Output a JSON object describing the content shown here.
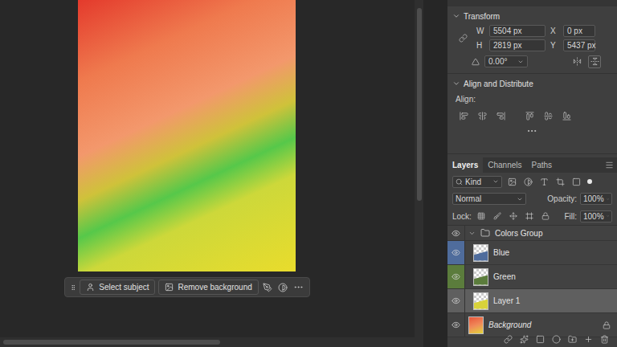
{
  "contextual_taskbar": {
    "buttons": [
      {
        "label": "Select subject"
      },
      {
        "label": "Remove background"
      }
    ]
  },
  "properties": {
    "transform": {
      "title": "Transform",
      "expanded": true,
      "fields": [
        {
          "label": "W",
          "value": "5504 px"
        },
        {
          "label": "X",
          "value": "0 px"
        },
        {
          "label": "H",
          "value": "2819 px"
        },
        {
          "label": "Y",
          "value": "5437 px"
        }
      ],
      "angle": "0.00°"
    },
    "align": {
      "title": "Align and Distribute",
      "expanded": true,
      "label": "Align:"
    }
  },
  "layers_panel": {
    "tabs": [
      {
        "label": "Layers",
        "selected": true
      },
      {
        "label": "Channels",
        "selected": false
      },
      {
        "label": "Paths",
        "selected": false
      }
    ],
    "filter": "Kind",
    "blend_mode": "Normal",
    "opacity_label": "Opacity:",
    "opacity": "100%",
    "lock_label": "Lock:",
    "fill_label": "Fill:",
    "fill": "100%",
    "layers": [
      {
        "name": "Colors Group",
        "kind": "group",
        "expanded": true,
        "visible": true,
        "selected": false,
        "child": false,
        "locked": false
      },
      {
        "name": "Blue",
        "kind": "layer",
        "visible": true,
        "selected": false,
        "child": true,
        "locked": false,
        "color": "#4f6c9c"
      },
      {
        "name": "Green",
        "kind": "layer",
        "visible": true,
        "selected": false,
        "child": true,
        "locked": false,
        "color": "#5b7c3c"
      },
      {
        "name": "Layer 1",
        "kind": "layer",
        "visible": true,
        "selected": true,
        "child": true,
        "locked": false
      },
      {
        "name": "Background",
        "kind": "background",
        "visible": true,
        "selected": false,
        "child": false,
        "locked": true
      }
    ]
  }
}
